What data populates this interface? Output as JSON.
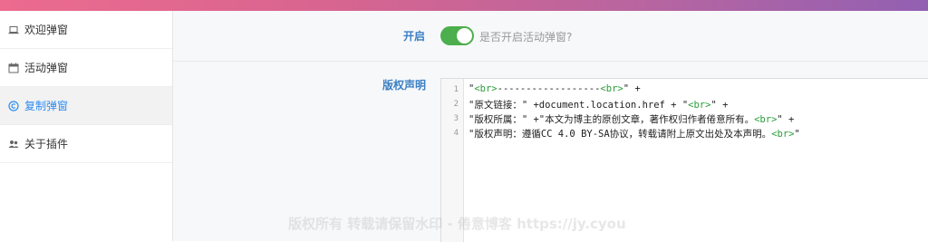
{
  "colors": {
    "accent": "#3a7fc3",
    "toggle_on": "#4cae4c",
    "code_tag": "#2a9d3a"
  },
  "sidebar": {
    "items": [
      {
        "label": "欢迎弹窗",
        "icon": "laptop-icon"
      },
      {
        "label": "活动弹窗",
        "icon": "calendar-icon"
      },
      {
        "label": "复制弹窗",
        "icon": "copyright-icon",
        "active": true
      },
      {
        "label": "关于插件",
        "icon": "users-icon"
      }
    ]
  },
  "enable": {
    "label": "开启",
    "on": true,
    "hint": "是否开启活动弹窗?"
  },
  "copyright": {
    "label": "版权声明",
    "lines": [
      {
        "no": "1",
        "parts": [
          "\"",
          "<br>",
          "------------------",
          "<br>",
          "\" +"
        ]
      },
      {
        "no": "2",
        "parts": [
          "\"原文链接：\" +document.location.href + \"",
          "<br>",
          "\" +"
        ]
      },
      {
        "no": "3",
        "parts": [
          "\"版权所属：\" +\"本文为博主的原创文章，著作权归作者倦意所有。",
          "<br>",
          "\" +"
        ]
      },
      {
        "no": "4",
        "parts": [
          "\"版权声明：遵循CC 4.0 BY-SA协议，转载请附上原文出处及本声明。",
          "<br>",
          "\""
        ]
      }
    ]
  },
  "watermark": "版权所有 转载请保留水印 - 倦意博客 https://jy.cyou"
}
